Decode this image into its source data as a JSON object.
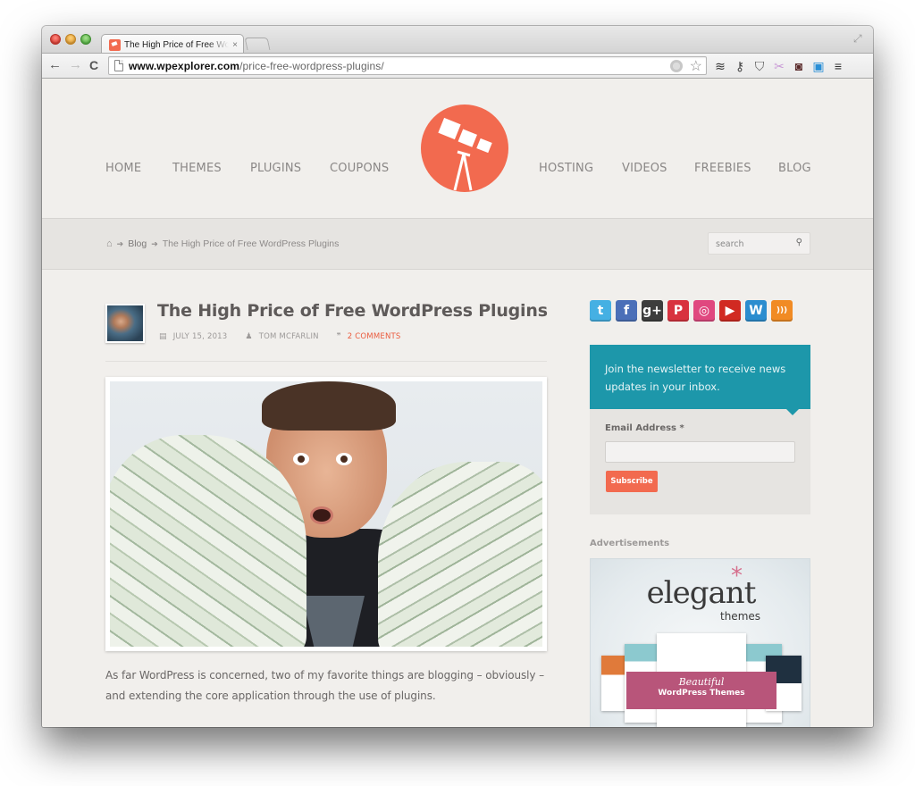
{
  "browser": {
    "tab_title": "The High Price of Free WordPress Plugins",
    "tab_close": "×",
    "url_domain": "www.wpexplorer.com",
    "url_path": "/price-free-wordpress-plugins/",
    "nav": {
      "back": "←",
      "forward": "→",
      "reload": "C"
    },
    "extensions": [
      {
        "name": "layers-icon",
        "glyph": "≋",
        "color": "#333333"
      },
      {
        "name": "key-icon",
        "glyph": "⚷",
        "color": "#444444"
      },
      {
        "name": "pocket-icon",
        "glyph": "⛉",
        "color": "#555555"
      },
      {
        "name": "scissors-icon",
        "glyph": "✂",
        "color": "#c99ad6"
      },
      {
        "name": "incognito-icon",
        "glyph": "◙",
        "color": "#5a2a2a"
      },
      {
        "name": "screenshot-icon",
        "glyph": "▣",
        "color": "#2a8fd6"
      },
      {
        "name": "menu-icon",
        "glyph": "≡",
        "color": "#333333"
      }
    ]
  },
  "site": {
    "nav_left": [
      "HOME",
      "THEMES",
      "PLUGINS",
      "COUPONS"
    ],
    "nav_right": [
      "HOSTING",
      "VIDEOS",
      "FREEBIES",
      "BLOG"
    ],
    "brand_color": "#f26a4f",
    "breadcrumb": {
      "home_icon": "⌂",
      "separator": "➔",
      "items": [
        "Blog",
        "The High Price of Free WordPress Plugins"
      ]
    },
    "search": {
      "placeholder": "search",
      "icon": "⚲"
    }
  },
  "article": {
    "title": "The High Price of Free WordPress Plugins",
    "date": "JULY 15, 2013",
    "author": "TOM MCFARLIN",
    "comments": "2 COMMENTS",
    "icons": {
      "date": "▤",
      "author": "♟",
      "comments": "❞"
    },
    "paragraphs": [
      "As far WordPress is concerned, two of my favorite things are blogging – obviously – and extending the core application through the use of plugins."
    ]
  },
  "sidebar": {
    "social": [
      {
        "name": "twitter",
        "glyph": "t",
        "color": "#45b0e3"
      },
      {
        "name": "facebook",
        "glyph": "f",
        "color": "#4b6fb8"
      },
      {
        "name": "google-plus",
        "glyph": "g+",
        "color": "#3d3d3d"
      },
      {
        "name": "pinterest",
        "glyph": "P",
        "color": "#d8323f"
      },
      {
        "name": "dribbble",
        "glyph": "◎",
        "color": "#e0487f"
      },
      {
        "name": "youtube",
        "glyph": "▶",
        "color": "#d12a22"
      },
      {
        "name": "wordpress",
        "glyph": "W",
        "color": "#2b8dcf"
      },
      {
        "name": "rss",
        "glyph": ")))",
        "color": "#f18b24"
      }
    ],
    "newsletter": {
      "text": "Join the newsletter to receive news updates in your inbox.",
      "email_label": "Email Address *",
      "email_value": "",
      "button": "Subscribe"
    },
    "ads": {
      "title": "Advertisements",
      "brand": "elegant",
      "brand_sub": "themes",
      "tagline_1": "Beautiful",
      "tagline_2": "WordPress Themes"
    }
  }
}
